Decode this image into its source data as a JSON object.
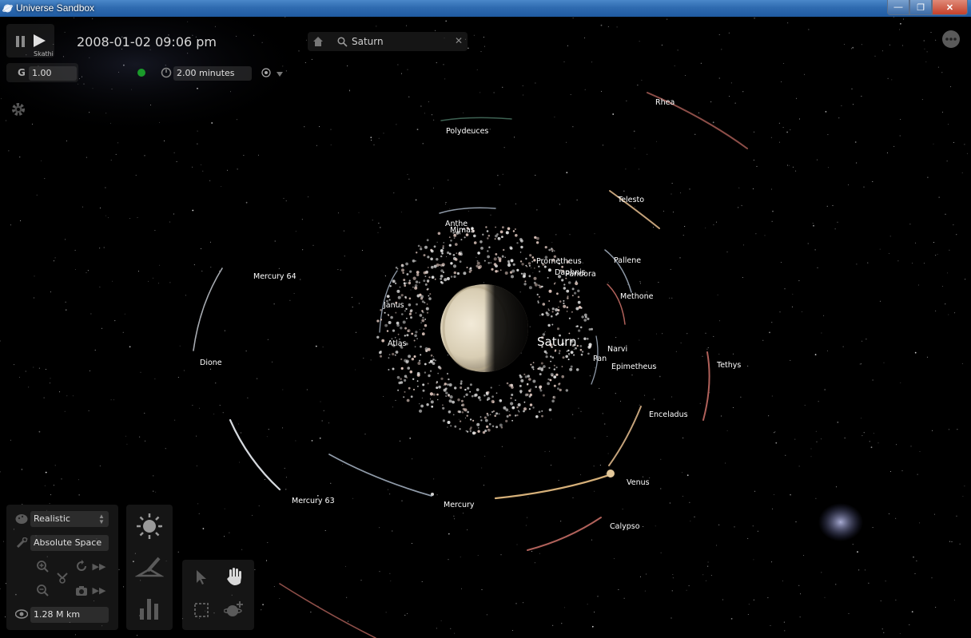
{
  "window": {
    "title": "Universe Sandbox"
  },
  "sim": {
    "date_time": "2008-01-02 09:06 pm",
    "focus_label": "Skathi",
    "gravity_label": "G",
    "gravity_value": "1.00",
    "time_step": "2.00 minutes"
  },
  "search": {
    "value": "Saturn"
  },
  "visual_mode": {
    "selected": "Realistic"
  },
  "space_mode": {
    "selected": "Absolute Space"
  },
  "view_distance": "1.28 M km",
  "planet_label": "Saturn",
  "moons": {
    "rhea": "Rhea",
    "polydeuces": "Polydeuces",
    "telesto": "Telesto",
    "anthe": "Anthe",
    "mimas": "Mimas",
    "mercury64": "Mercury 64",
    "prometheus": "Prometheus",
    "pallene": "Pallene",
    "daphnis": "Daphnis",
    "pandora": "Pandora",
    "janus": "Janus",
    "methone": "Methone",
    "atlas": "Atlas",
    "narvi": "Narvi",
    "dione": "Dione",
    "pan": "Pan",
    "epimetheus": "Epimetheus",
    "tethys": "Tethys",
    "enceladus": "Enceladus",
    "venus": "Venus",
    "mercury63": "Mercury 63",
    "mercury": "Mercury",
    "calypso": "Calypso"
  },
  "colors": {
    "title_bar": "#2f6bb0",
    "background": "#000000",
    "status_green": "#1a9a2a",
    "orbit_red": "#b0615a",
    "orbit_gray": "#b9bec4"
  },
  "icons": {
    "pause": "pause-icon",
    "play": "play-icon",
    "home": "home-icon",
    "search": "search-icon",
    "clear": "close-icon",
    "settings": "gear-icon",
    "more": "more-icon",
    "sun": "sun-icon",
    "stats": "bar-chart-icon",
    "select": "pointer-icon",
    "pan": "hand-icon"
  }
}
